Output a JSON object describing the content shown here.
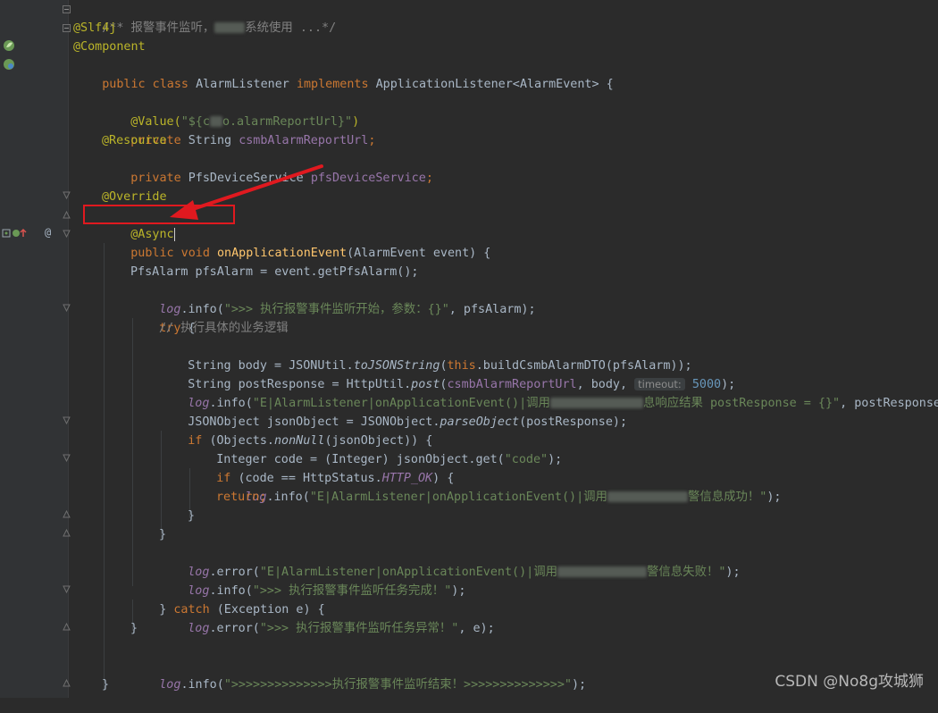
{
  "editor": {
    "lines": {
      "l1": "/** 报警事件监听，",
      "l1b": "系统使用 ...*/",
      "l2": "@Slf4j",
      "l3": "@Component",
      "l4_kw1": "public class ",
      "l4_name": "AlarmListener ",
      "l4_kw2": "implements ",
      "l4_rest": "ApplicationListener<AlarmEvent> {",
      "l6_an": "@Value(",
      "l6_str": "\"${c",
      "l6_str2": "o.alarmReportUrl}\"",
      "l6_end": ")",
      "l7_kw": "private ",
      "l7_type": "String ",
      "l7_fld": "csmbAlarmReportUrl",
      "l7_end": ";",
      "l8": "@Resource",
      "l9_kw": "private ",
      "l9_type": "PfsDeviceService ",
      "l9_fld": "pfsDeviceService",
      "l9_end": ";",
      "l11": "@Override",
      "l12": "@Async",
      "l13_kw": "public void ",
      "l13_fn": "onApplicationEvent",
      "l13_rest": "(AlarmEvent event) {",
      "l15": "PfsAlarm pfsAlarm = event.getPfsAlarm();",
      "l16_log": "log",
      "l16_a": ".info(",
      "l16_str": "\">>> 执行报警事件监听开始，参数：{}\"",
      "l16_b": ", pfsAlarm);",
      "l17_kw": "try ",
      "l17_b": "{",
      "l18": "// 执行具体的业务逻辑",
      "l19_a": "String body = JSONUtil.",
      "l19_it": "toJSONString",
      "l19_b": "(",
      "l19_kw": "this",
      "l19_c": ".buildCsmbAlarmDTO(pfsAlarm));",
      "l20_a": "String postResponse = HttpUtil.",
      "l20_it": "post",
      "l20_b": "(",
      "l20_fld": "csmbAlarmReportUrl",
      "l20_c": ", body, ",
      "l20_hint": "timeout:",
      "l20_num": "5000",
      "l20_d": ");",
      "l21_log": "log",
      "l21_a": ".info(",
      "l21_str": "\"E|AlarmListener|onApplicationEvent()|调用",
      "l21_str2": "息响应结果 postResponse = {}\"",
      "l21_b": ", postResponse);",
      "l22_a": "JSONObject jsonObject = JSONObject.",
      "l22_it": "parseObject",
      "l22_b": "(postResponse);",
      "l23_kw": "if ",
      "l23_a": "(Objects.",
      "l23_it": "nonNull",
      "l23_b": "(jsonObject)) {",
      "l24_a": "Integer code = (Integer) jsonObject.get(",
      "l24_str": "\"code\"",
      "l24_b": ");",
      "l25_kw": "if ",
      "l25_a": "(code == HttpStatus.",
      "l25_it": "HTTP_OK",
      "l25_b": ") {",
      "l26_log": "log",
      "l26_a": ".info(",
      "l26_str": "\"E|AlarmListener|onApplicationEvent()|调用",
      "l26_str2": "警信息成功！\"",
      "l26_b": ");",
      "l27": "return;",
      "l28": "}",
      "l29": "}",
      "l30_log": "log",
      "l30_a": ".error(",
      "l30_str": "\"E|AlarmListener|onApplicationEvent()|调用",
      "l30_str2": "警信息失败！\"",
      "l30_b": ");",
      "l31_log": "log",
      "l31_a": ".info(",
      "l31_str": "\">>> 执行报警事件监听任务完成！\"",
      "l31_b": ");",
      "l32_a": "} ",
      "l32_kw": "catch ",
      "l32_b": "(Exception e) {",
      "l33_log": "log",
      "l33_a": ".error(",
      "l33_str": "\">>> 执行报警事件监听任务异常！\"",
      "l33_b": ", e);",
      "l34": "}",
      "l36_log": "log",
      "l36_a": ".info(",
      "l36_str": "\">>>>>>>>>>>>>>执行报警事件监听结束！>>>>>>>>>>>>>>\"",
      "l36_b": ");",
      "l37": "}"
    },
    "gutter": {
      "override_marker": "@"
    },
    "colors": {
      "background": "#2b2b2b",
      "keyword": "#cc7832",
      "annotation": "#bbb529",
      "string": "#6a8759",
      "method": "#ffc66d",
      "field": "#9876aa",
      "highlight_box": "#e0191f"
    }
  },
  "watermark": "CSDN @No8g攻城狮"
}
